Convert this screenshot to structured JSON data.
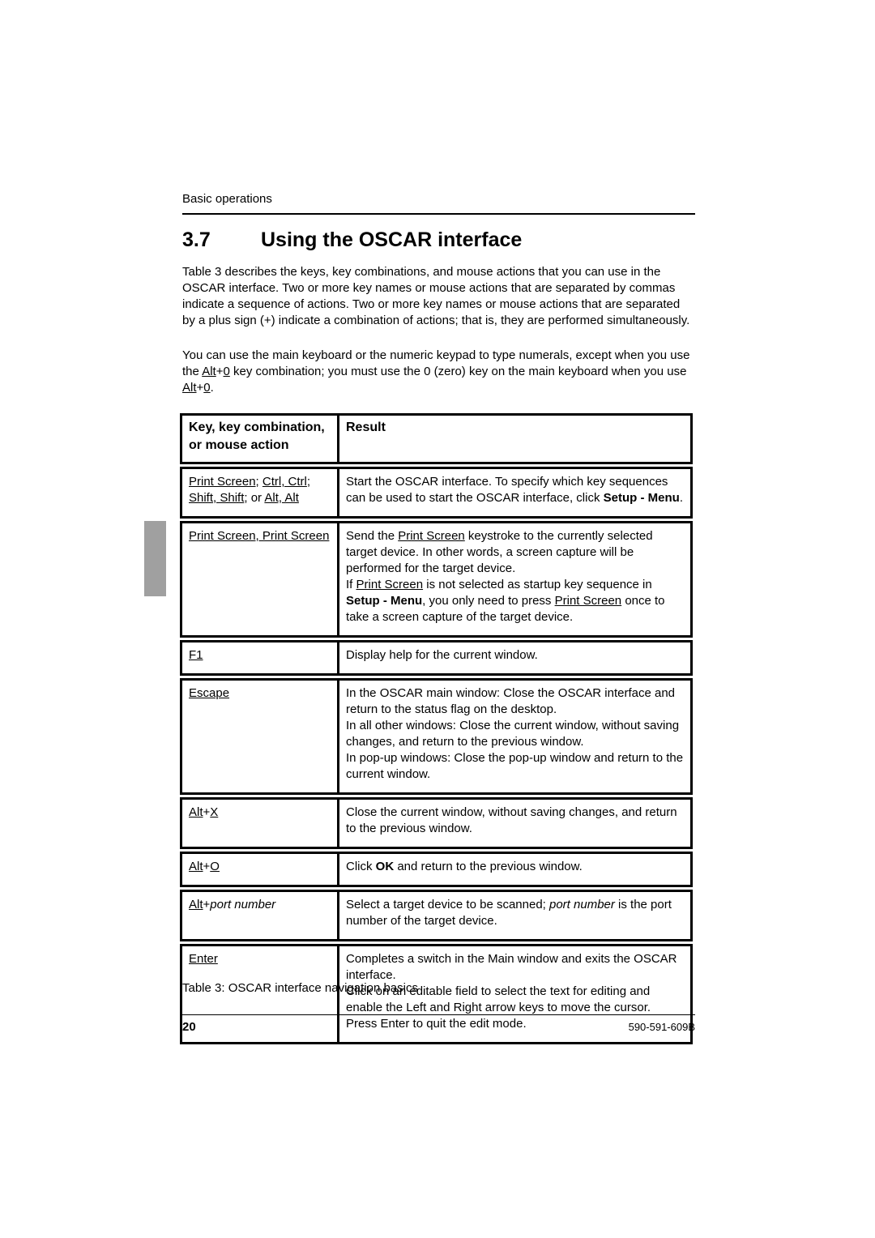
{
  "running_head": "Basic operations",
  "section": {
    "number": "3.7",
    "title": "Using the OSCAR interface"
  },
  "intro": {
    "p1": "Table 3 describes the keys, key combinations, and mouse actions that you can use in the OSCAR interface. Two or more key names or mouse actions that are separated by commas indicate a sequence of actions. Two or more key names or mouse actions that are separated by a plus sign (+) indicate a combination of actions; that is, they are performed simultaneously.",
    "p2_a": "You can use the main keyboard or the numeric keypad to type numerals, except when you use the ",
    "p2_alt1": "Alt",
    "p2_plus1": "+",
    "p2_zero1": "0",
    "p2_b": " key combination; you must use the 0 (zero) key on the main keyboard when you use ",
    "p2_alt2": "Alt",
    "p2_plus2": "+",
    "p2_zero2": "0",
    "p2_c": "."
  },
  "table": {
    "header": {
      "key": "Key, key combination, or mouse action",
      "result": "Result"
    },
    "rows": [
      {
        "key_parts": [
          "Print Screen",
          "; ",
          "Ctrl, Ctrl",
          ";",
          "Shift, Shift",
          "; or ",
          "Alt, Alt"
        ],
        "result_parts": [
          "Start the OSCAR interface. To specify which key sequences can be used to start the OSCAR interface, click ",
          "Setup - Menu",
          "."
        ]
      },
      {
        "key": "Print Screen, Print Screen",
        "result_parts": [
          "Send the ",
          "Print Screen",
          " keystroke to the currently selected target device. In other words, a screen capture will be performed for the target device.",
          "If ",
          "Print Screen",
          " is not selected as startup key sequence in ",
          "Setup - Menu",
          ", you only need to press ",
          "Print Screen",
          " once to take a screen capture of the target device."
        ]
      },
      {
        "key": "F1",
        "result": "Display help for the current window."
      },
      {
        "key": "Escape",
        "result_lines": [
          "In the OSCAR main window: Close the OSCAR interface and return to the status flag on the desktop.",
          "In all other windows: Close the current window, without saving changes, and return to the previous window.",
          "In pop-up windows: Close the pop-up window and return to the current window."
        ]
      },
      {
        "key_parts": [
          "Alt",
          "+",
          "X"
        ],
        "result": "Close the current window, without saving changes, and return to the previous window."
      },
      {
        "key_parts": [
          "Alt",
          "+",
          "O"
        ],
        "result_parts": [
          "Click ",
          "OK",
          " and return to the previous window."
        ]
      },
      {
        "key_parts": [
          "Alt",
          "+",
          "port number"
        ],
        "result_parts": [
          "Select a target device to be scanned; ",
          "port number",
          " is the port number of the target device."
        ]
      },
      {
        "key": "Enter",
        "result_lines": [
          "Completes a switch in the Main window and exits the OSCAR interface.",
          "Click on an editable field to select the text for editing and enable the Left and Right arrow keys to move the cursor.",
          "Press Enter to quit the edit mode."
        ]
      }
    ]
  },
  "caption": "Table 3: OSCAR interface navigation basics",
  "footer": {
    "page_number": "20",
    "doc_id": "590-591-609B"
  }
}
